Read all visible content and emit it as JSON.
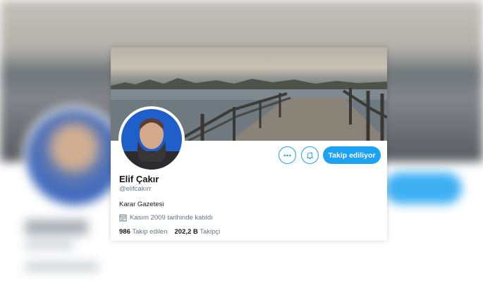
{
  "profile": {
    "name": "Elif Çakır",
    "handle": "@elifcakırr",
    "bio": "Karar Gazetesi",
    "joined": "Kasım 2009 tarihinde katıldı",
    "following_count": "986",
    "following_label": "Takip edilen",
    "followers_count": "202,2 B",
    "followers_label": "Takipçi"
  },
  "actions": {
    "follow_label": "Takip ediliyor",
    "more_icon": "more-icon",
    "bell_icon": "bell-icon"
  },
  "colors": {
    "accent": "#1da1f2",
    "text_primary": "#14171a",
    "text_secondary": "#657786"
  }
}
